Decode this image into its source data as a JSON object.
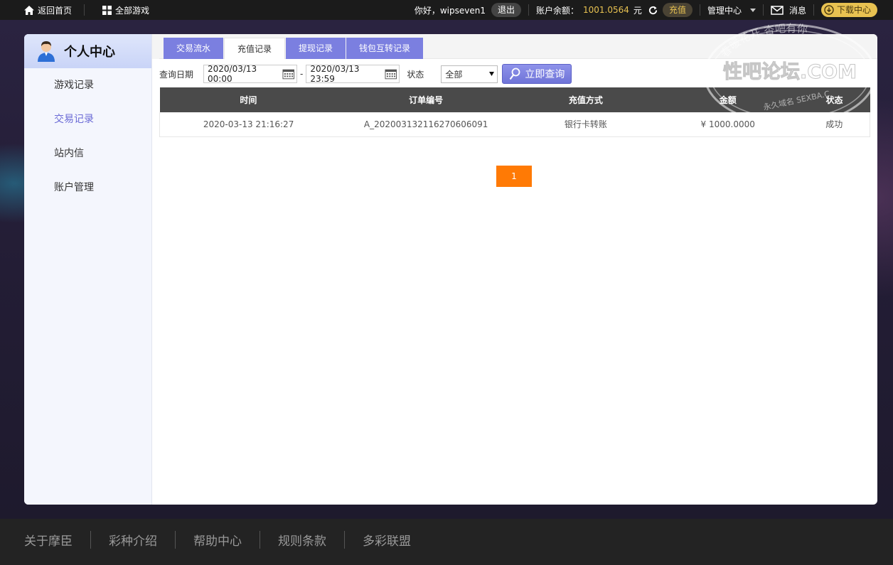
{
  "topbar": {
    "home": "返回首页",
    "games": "全部游戏",
    "greeting": "你好，wipseven1",
    "logout": "退出",
    "balance_label": "账户余额：",
    "balance_value": "1001.0564",
    "balance_unit": "元",
    "recharge": "充值",
    "manage": "管理中心",
    "messages": "消息",
    "download": "下载中心"
  },
  "sidebar": {
    "title": "个人中心",
    "items": [
      {
        "label": "游戏记录"
      },
      {
        "label": "交易记录"
      },
      {
        "label": "站内信"
      },
      {
        "label": "账户管理"
      }
    ]
  },
  "tabs": [
    {
      "label": "交易流水"
    },
    {
      "label": "充值记录"
    },
    {
      "label": "提现记录"
    },
    {
      "label": "钱包互转记录"
    }
  ],
  "query": {
    "date_label": "查询日期",
    "date_from": "2020/03/13 00:00",
    "date_sep": "-",
    "date_to": "2020/03/13 23:59",
    "status_label": "状态",
    "status_value": "全部",
    "submit": "立即查询"
  },
  "table": {
    "headers": [
      "时间",
      "订单编号",
      "充值方式",
      "金额",
      "状态"
    ],
    "rows": [
      [
        "2020-03-13 21:16:27",
        "A_202003132116270606091",
        "银行卡转账",
        "¥ 1000.0000",
        "成功"
      ]
    ]
  },
  "pager": {
    "current": "1"
  },
  "watermark": {
    "arc_text": "春暖花开 杏吧有你",
    "main": "性吧论坛.COM",
    "sub": "永久域名 SEXBA.C"
  },
  "footer": {
    "links": [
      "关于摩臣",
      "彩种介绍",
      "帮助中心",
      "规则条款",
      "多彩联盟"
    ]
  },
  "colors": {
    "accent": "#7b7fe0",
    "gold": "#e8c251",
    "pager": "#ff7a05",
    "table_header": "#4a4a4a"
  }
}
